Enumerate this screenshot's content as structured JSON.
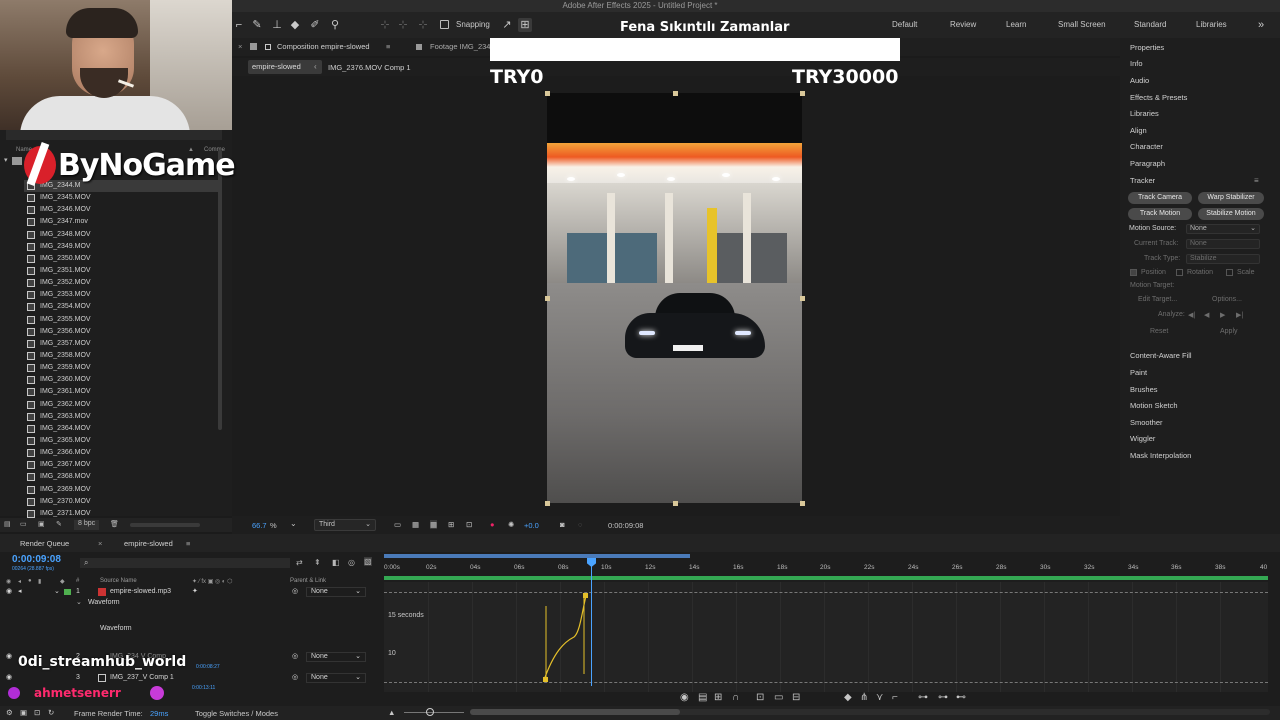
{
  "window": {
    "title": "Adobe After Effects 2025 - Untitled Project *"
  },
  "toolbar": {
    "snapping_label": "Snapping"
  },
  "workspaces": [
    "Default",
    "Review",
    "Learn",
    "Small Screen",
    "Standard",
    "Libraries"
  ],
  "overlay": {
    "title": "Fena Sıkıntılı Zamanlar",
    "progress_min": "TRY0",
    "progress_max": "TRY30000",
    "progress_fraction": 1.0
  },
  "brand": {
    "logo_text": "ByNoGame"
  },
  "project": {
    "header": {
      "name_col": "Name",
      "comment_col": "Comme"
    },
    "files": [
      "IMG_2344.M",
      "IMG_2345.MOV",
      "IMG_2346.MOV",
      "IMG_2347.mov",
      "IMG_2348.MOV",
      "IMG_2349.MOV",
      "IMG_2350.MOV",
      "IMG_2351.MOV",
      "IMG_2352.MOV",
      "IMG_2353.MOV",
      "IMG_2354.MOV",
      "IMG_2355.MOV",
      "IMG_2356.MOV",
      "IMG_2357.MOV",
      "IMG_2358.MOV",
      "IMG_2359.MOV",
      "IMG_2360.MOV",
      "IMG_2361.MOV",
      "IMG_2362.MOV",
      "IMG_2363.MOV",
      "IMG_2364.MOV",
      "IMG_2365.MOV",
      "IMG_2366.MOV",
      "IMG_2367.MOV",
      "IMG_2368.MOV",
      "IMG_2369.MOV",
      "IMG_2370.MOV",
      "IMG_2371.MOV"
    ],
    "bpc": "8 bpc"
  },
  "composition": {
    "tab_label": "Composition empire-slowed",
    "footage_tab": "Footage IMG_234",
    "crumb_active": "empire-slowed",
    "crumb_second": "IMG_2376.MOV Comp 1",
    "zoom": "66.7",
    "zoom_unit": "%",
    "resolution": "Third",
    "exposure": "+0.0",
    "timecode": "0:00:09:08"
  },
  "right_panel": {
    "items_top": [
      "Properties",
      "Info",
      "Audio",
      "Effects & Presets",
      "Libraries",
      "Align",
      "Character",
      "Paragraph",
      "Tracker"
    ],
    "buttons": [
      "Track Camera",
      "Warp Stabilizer",
      "Track Motion",
      "Stabilize Motion"
    ],
    "motion_source_label": "Motion Source:",
    "motion_source_value": "None",
    "current_track_label": "Current Track:",
    "current_track_value": "None",
    "track_type_label": "Track Type:",
    "track_type_value": "Stabilize",
    "position": "Position",
    "rotation": "Rotation",
    "scale": "Scale",
    "motion_target": "Motion Target:",
    "edit_target": "Edit Target...",
    "options": "Options...",
    "analyze": "Analyze:",
    "reset": "Reset",
    "apply": "Apply",
    "items_bottom": [
      "Content-Aware Fill",
      "Paint",
      "Brushes",
      "Motion Sketch",
      "Smoother",
      "Wiggler",
      "Mask Interpolation"
    ]
  },
  "timeline": {
    "tab_render": "Render Queue",
    "tab_comp": "empire-slowed",
    "time": "0:00:09:08",
    "frames": "00264 (28.887 fps)",
    "col_source": "Source Name",
    "col_parent": "Parent & Link",
    "layers": [
      {
        "num": "1",
        "name": "empire-slowed.mp3",
        "parent": "None"
      },
      {
        "num": "2",
        "name": "IMG_234 V Comp",
        "parent": "None"
      },
      {
        "num": "3",
        "name": "IMG_237_V Comp 1",
        "parent": "None"
      }
    ],
    "waveform_group": "Waveform",
    "waveform_item": "Waveform",
    "layer2_time": "0:00:08:27",
    "layer3_time": "0:00:13:11",
    "ruler": [
      "0:00s",
      "02s",
      "04s",
      "06s",
      "08s",
      "10s",
      "12s",
      "14s",
      "16s",
      "18s",
      "20s",
      "22s",
      "24s",
      "26s",
      "28s",
      "30s",
      "32s",
      "34s",
      "36s",
      "38s",
      "40"
    ],
    "graph_label_top": "15 seconds",
    "graph_label_low": "10",
    "render_time_label": "Frame Render Time:",
    "render_time_value": "29ms",
    "toggle_label": "Toggle Switches / Modes"
  },
  "stream": {
    "viewer1": "0di_streamhub_world",
    "viewer2": "ahmetsenerr"
  }
}
